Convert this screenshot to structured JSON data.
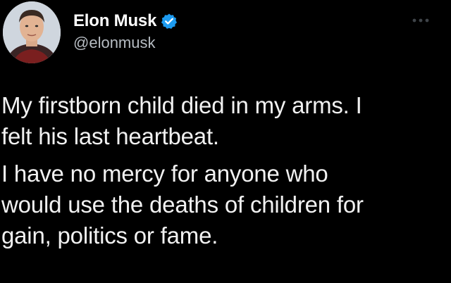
{
  "tweet": {
    "author": {
      "display_name": "Elon Musk",
      "handle": "@elonmusk",
      "verified": true,
      "avatar_icon": "profile-avatar",
      "verified_icon": "verified-badge-icon"
    },
    "more_icon": "more-dots-icon",
    "paragraphs": [
      "My firstborn child died in my arms. I\nfelt his last heartbeat.",
      "I have no mercy for anyone who\nwould use the deaths of children for\ngain, politics or fame."
    ],
    "colors": {
      "background": "#000000",
      "text": "#e7e9ea",
      "secondary_text": "#b6bcc2",
      "verified_blue": "#1d9bf0"
    }
  }
}
